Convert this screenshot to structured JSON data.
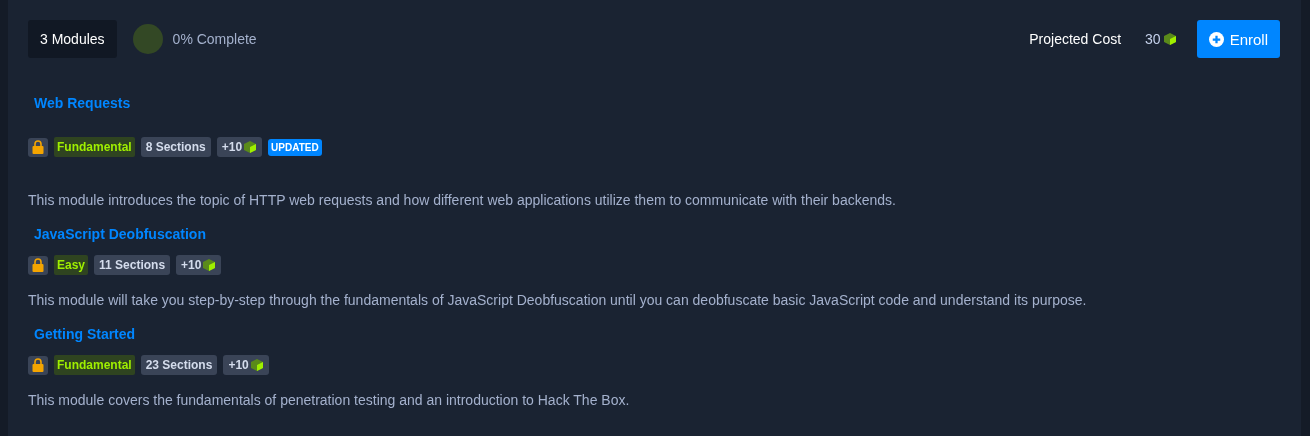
{
  "header": {
    "module_count": "3 Modules",
    "progress": {
      "label": "0% Complete"
    },
    "cost_label": "Projected Cost",
    "cost": "30",
    "enroll": "Enroll"
  },
  "modules": [
    {
      "title": "Web Requests",
      "locked": true,
      "difficulty": "Fundamental",
      "sections": "8 Sections",
      "reward": "+10",
      "updated": "UPDATED",
      "description": "This module introduces the topic of HTTP web requests and how different web applications utilize them to communicate with their backends."
    },
    {
      "title": "JavaScript Deobfuscation",
      "locked": true,
      "difficulty": "Easy",
      "sections": "11 Sections",
      "reward": "+10",
      "description": "This module will take you step-by-step through the fundamentals of JavaScript Deobfuscation until you can deobfuscate basic JavaScript code and understand its purpose."
    },
    {
      "title": "Getting Started",
      "locked": true,
      "difficulty": "Fundamental",
      "sections": "23 Sections",
      "reward": "+10",
      "description": "This module covers the fundamentals of penetration testing and an introduction to Hack The Box."
    }
  ]
}
